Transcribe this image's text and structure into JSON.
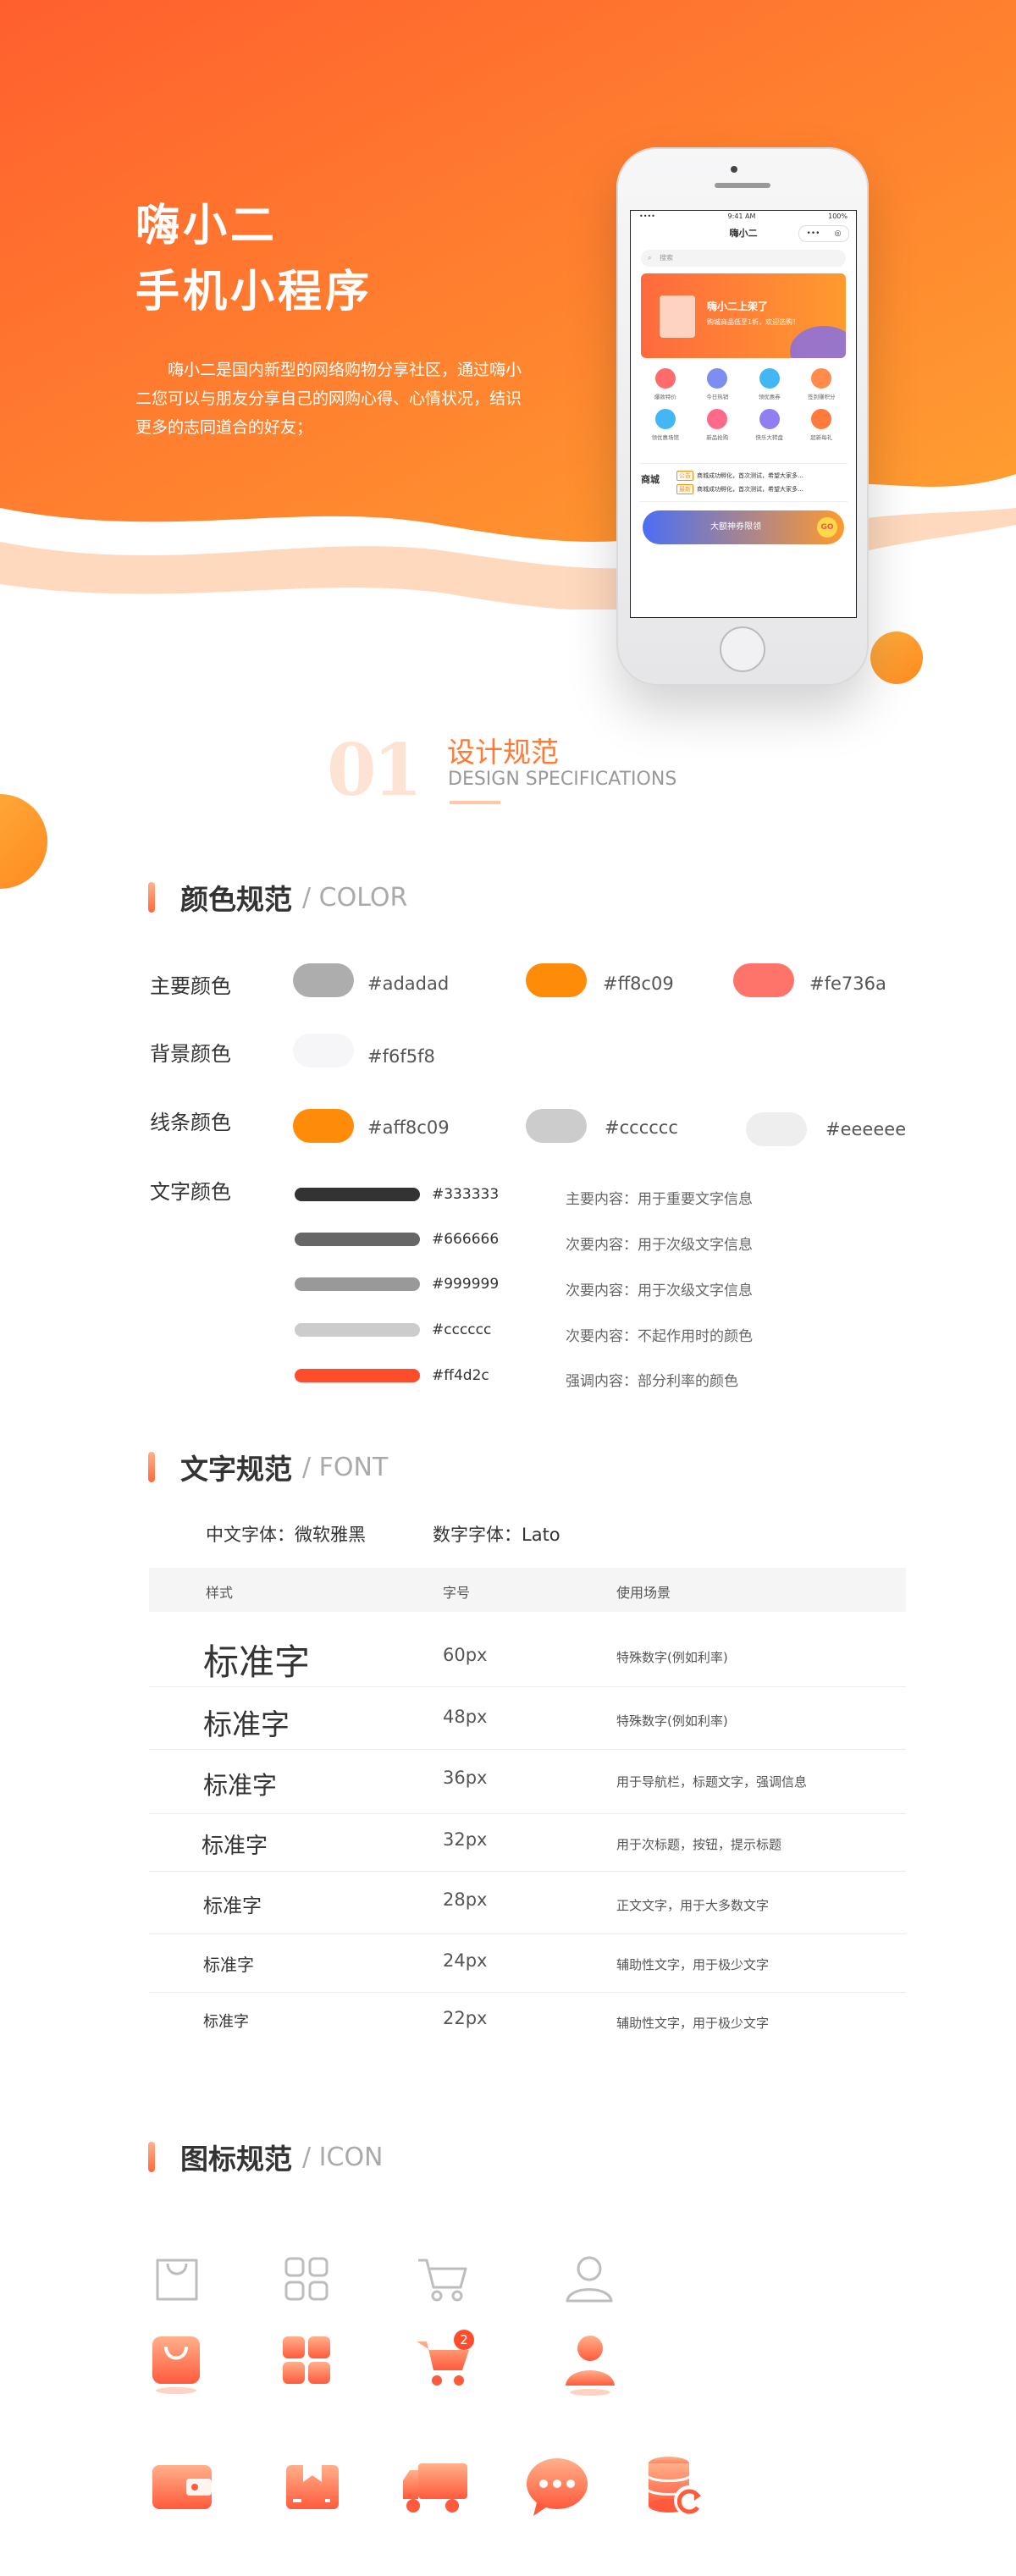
{
  "hero": {
    "title_line1": "嗨小二",
    "title_line2": "手机小程序",
    "description": "嗨小二是国内新型的网络购物分享社区，通过嗨小二您可以与朋友分享自己的网购心得、心情状况，结识更多的志同道合的好友；"
  },
  "phone": {
    "time": "9:41 AM",
    "battery": "100%",
    "title": "嗨小二",
    "capsule_dots": "•••",
    "search_placeholder": "搜索",
    "banner_title": "嗨小二上架了",
    "banner_sub": "购城商品低至1折，欢迎选购！",
    "grid": [
      "爆款特价",
      "今日热销",
      "领优惠券",
      "签到赚积分",
      "领优惠场馆",
      "新品抢购",
      "快乐大转盘",
      "超新每礼"
    ],
    "news_label": "商城",
    "news_tag1": "公告",
    "news_tag2": "最新",
    "news1": "商城成功孵化，首次测试，希望大家多…",
    "news2": "商城成功孵化，首次测试，希望大家多…",
    "promo_text": "大额神券限领",
    "promo_go": "GO",
    "colors": {
      "grid": [
        "#ff6a6a",
        "#7f8df0",
        "#43b6f5",
        "#ff8c4a",
        "#43b6f5",
        "#ff6a8a",
        "#8f7ff0",
        "#ff7a3d"
      ]
    }
  },
  "section": {
    "number": "01",
    "title": "设计规范",
    "subtitle": "DESIGN SPECIFICATIONS"
  },
  "color_spec": {
    "heading_cn": "颜色规范",
    "heading_en": "/ COLOR",
    "main_label": "主要颜色",
    "bg_label": "背景颜色",
    "line_label": "线条颜色",
    "text_label": "文字颜色",
    "main": [
      {
        "hex": "#adadad",
        "color": "#adadad"
      },
      {
        "hex": "#ff8c09",
        "color": "#ff8c09"
      },
      {
        "hex": "#fe736a",
        "color": "#fe736a"
      }
    ],
    "bg": [
      {
        "hex": "#f6f5f8",
        "color": "#f6f5f8"
      }
    ],
    "line": [
      {
        "hex": "#aff8c09",
        "color": "#ff8c09"
      },
      {
        "hex": "#cccccc",
        "color": "#cccccc"
      },
      {
        "hex": "#eeeeee",
        "color": "#eeeeee"
      }
    ],
    "text": [
      {
        "hex": "#333333",
        "color": "#333333",
        "desc": "主要内容：用于重要文字信息"
      },
      {
        "hex": "#666666",
        "color": "#666666",
        "desc": "次要内容：用于次级文字信息"
      },
      {
        "hex": "#999999",
        "color": "#999999",
        "desc": "次要内容：用于次级文字信息"
      },
      {
        "hex": "#cccccc",
        "color": "#cccccc",
        "desc": "次要内容：不起作用时的颜色"
      },
      {
        "hex": "#ff4d2c",
        "color": "#ff4d2c",
        "desc": "强调内容：部分利率的颜色"
      }
    ]
  },
  "font_spec": {
    "heading_cn": "文字规范",
    "heading_en": "/ FONT",
    "cn_font": "中文字体：微软雅黑",
    "num_font": "数字字体：Lato",
    "col_style": "样式",
    "col_size": "字号",
    "col_use": "使用场景",
    "rows": [
      {
        "sample": "标准字",
        "size": "60px",
        "use": "特殊数字(例如利率)"
      },
      {
        "sample": "标准字",
        "size": "48px",
        "use": "特殊数字(例如利率)"
      },
      {
        "sample": "标准字",
        "size": "36px",
        "use": "用于导航栏，标题文字，强调信息"
      },
      {
        "sample": "标准字",
        "size": "32px",
        "use": "用于次标题，按钮，提示标题"
      },
      {
        "sample": "标准字",
        "size": "28px",
        "use": "正文文字，用于大多数文字"
      },
      {
        "sample": "标准字",
        "size": "24px",
        "use": "辅助性文字，用于极少文字"
      },
      {
        "sample": "标准字",
        "size": "22px",
        "use": "辅助性文字，用于极少文字"
      }
    ]
  },
  "icon_spec": {
    "heading_cn": "图标规范",
    "heading_en": "/ ICON",
    "cart_badge": "2",
    "icons": [
      "bag-icon",
      "grid-icon",
      "cart-icon",
      "user-icon",
      "wallet-icon",
      "bookmark-icon",
      "truck-icon",
      "chat-icon",
      "coins-icon"
    ],
    "colors": {
      "outline": "#bdbdbd",
      "accent_from": "#ffb08a",
      "accent_to": "#ff5a3c",
      "badge": "#ff4d2c"
    }
  }
}
